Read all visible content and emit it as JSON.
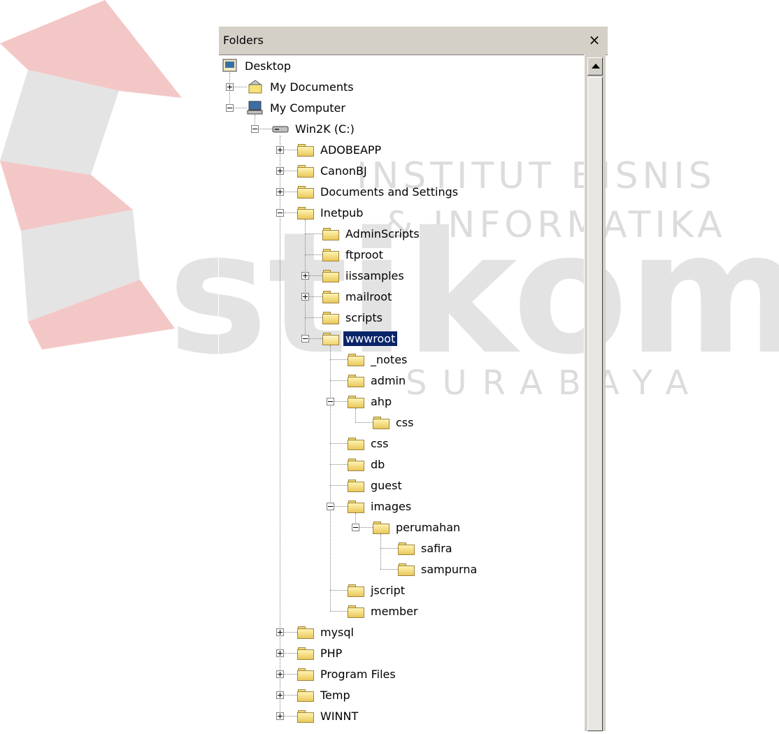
{
  "watermark": {
    "line1": "INSTITUT BISNIS",
    "line2": "& INFORMATIKA",
    "brand": "stikom",
    "city": "SURABAYA"
  },
  "pane": {
    "title": "Folders",
    "close_glyph": "×"
  },
  "tree": [
    {
      "label": "Desktop",
      "icon": "desktop-icon",
      "depth": 0,
      "expander": "none"
    },
    {
      "label": "My Documents",
      "icon": "my-documents-icon",
      "depth": 1,
      "expander": "plus"
    },
    {
      "label": "My Computer",
      "icon": "my-computer-icon",
      "depth": 1,
      "expander": "minus"
    },
    {
      "label": "Win2K (C:)",
      "icon": "drive-icon",
      "depth": 2,
      "expander": "minus"
    },
    {
      "label": "ADOBEAPP",
      "icon": "folder-icon",
      "depth": 3,
      "expander": "plus"
    },
    {
      "label": "CanonBJ",
      "icon": "folder-icon",
      "depth": 3,
      "expander": "plus"
    },
    {
      "label": "Documents and Settings",
      "icon": "folder-icon",
      "depth": 3,
      "expander": "plus"
    },
    {
      "label": "Inetpub",
      "icon": "folder-icon",
      "depth": 3,
      "expander": "minus"
    },
    {
      "label": "AdminScripts",
      "icon": "folder-icon",
      "depth": 4,
      "expander": "none"
    },
    {
      "label": "ftproot",
      "icon": "folder-icon",
      "depth": 4,
      "expander": "none"
    },
    {
      "label": "iissamples",
      "icon": "folder-icon",
      "depth": 4,
      "expander": "plus"
    },
    {
      "label": "mailroot",
      "icon": "folder-icon",
      "depth": 4,
      "expander": "plus"
    },
    {
      "label": "scripts",
      "icon": "folder-icon",
      "depth": 4,
      "expander": "none"
    },
    {
      "label": "wwwroot",
      "icon": "open-folder-icon",
      "depth": 4,
      "expander": "minus",
      "selected": true
    },
    {
      "label": "_notes",
      "icon": "folder-icon",
      "depth": 5,
      "expander": "none"
    },
    {
      "label": "admin",
      "icon": "folder-icon",
      "depth": 5,
      "expander": "none"
    },
    {
      "label": "ahp",
      "icon": "folder-icon",
      "depth": 5,
      "expander": "minus"
    },
    {
      "label": "css",
      "icon": "folder-icon",
      "depth": 6,
      "expander": "none"
    },
    {
      "label": "css",
      "icon": "folder-icon",
      "depth": 5,
      "expander": "none"
    },
    {
      "label": "db",
      "icon": "folder-icon",
      "depth": 5,
      "expander": "none"
    },
    {
      "label": "guest",
      "icon": "folder-icon",
      "depth": 5,
      "expander": "none"
    },
    {
      "label": "images",
      "icon": "folder-icon",
      "depth": 5,
      "expander": "minus"
    },
    {
      "label": "perumahan",
      "icon": "folder-icon",
      "depth": 6,
      "expander": "minus"
    },
    {
      "label": "safira",
      "icon": "folder-icon",
      "depth": 7,
      "expander": "none"
    },
    {
      "label": "sampurna",
      "icon": "folder-icon",
      "depth": 7,
      "expander": "none"
    },
    {
      "label": "jscript",
      "icon": "folder-icon",
      "depth": 5,
      "expander": "none"
    },
    {
      "label": "member",
      "icon": "folder-icon",
      "depth": 5,
      "expander": "none"
    },
    {
      "label": "mysql",
      "icon": "folder-icon",
      "depth": 3,
      "expander": "plus"
    },
    {
      "label": "PHP",
      "icon": "folder-icon",
      "depth": 3,
      "expander": "plus"
    },
    {
      "label": "Program Files",
      "icon": "folder-icon",
      "depth": 3,
      "expander": "plus"
    },
    {
      "label": "Temp",
      "icon": "folder-icon",
      "depth": 3,
      "expander": "plus"
    },
    {
      "label": "WINNT",
      "icon": "folder-icon",
      "depth": 3,
      "expander": "plus"
    }
  ]
}
